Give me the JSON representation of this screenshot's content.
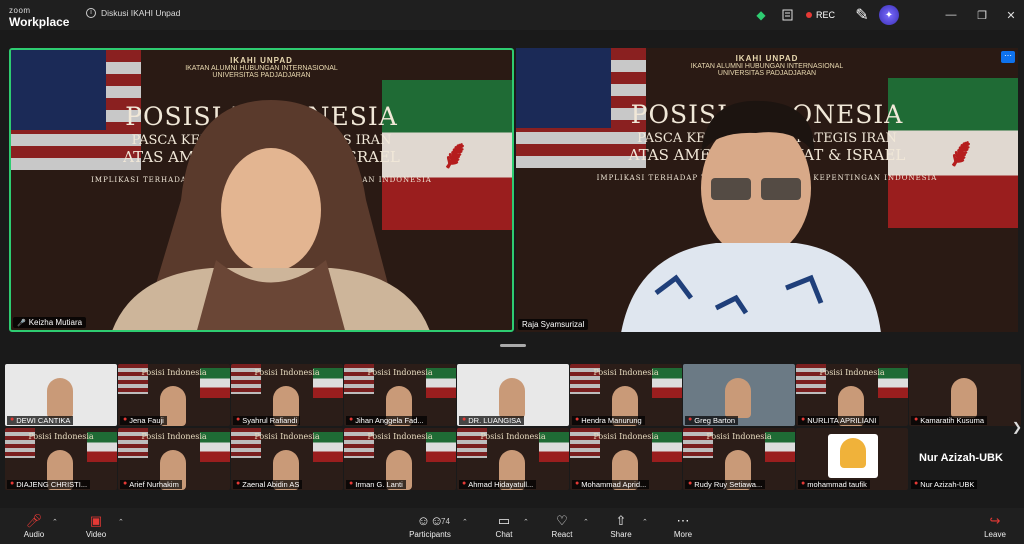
{
  "app": {
    "brand_line1": "zoom",
    "brand_line2": "Workplace"
  },
  "meeting": {
    "title": "Diskusi IKAHI Unpad"
  },
  "recording": {
    "label": "REC",
    "color": "#e53935"
  },
  "icons": {
    "security": "shield-check-icon",
    "notes": "document-icon",
    "annotate": "pen-icon",
    "ai": "ai-companion-icon"
  },
  "poster": {
    "brand": "IKAHI UNPAD",
    "org1": "IKATAN ALUMNI HUBUNGAN INTERNASIONAL",
    "org2": "UNIVERSITAS PADJADJARAN",
    "line1": "POSISI INDONESIA",
    "line2": "PASCA KEPUTUSAN STRATEGIS IRAN",
    "line3": "ATAS AMERIKA SERIKAT & ISRAEL",
    "line4": "IMPLIKASI TERHADAP TATANAN GLOBAL, DAN KEPENTINGAN INDONESIA"
  },
  "speakers": [
    {
      "name": "Keizha Mutiara",
      "active": true
    },
    {
      "name": "Raja Syamsurizal",
      "active": false
    }
  ],
  "gallery": [
    {
      "name": "DEWI CANTIKA"
    },
    {
      "name": "Jena Fauji"
    },
    {
      "name": "Syahrul Rafiandi"
    },
    {
      "name": "Jihan Anggela Fad..."
    },
    {
      "name": "DR. LUANGISA"
    },
    {
      "name": "Hendra Manurung"
    },
    {
      "name": "Greg Barton"
    },
    {
      "name": "NURLITA APRILIANI"
    },
    {
      "name": "Kamaratih Kusuma"
    },
    {
      "name": "DIAJENG CHRISTI..."
    },
    {
      "name": "Arief Nurhakim"
    },
    {
      "name": "Zaenal Abidin AS"
    },
    {
      "name": "Irman G. Lanti"
    },
    {
      "name": "Ahmad Hidayatull..."
    },
    {
      "name": "Mohammad Aprid..."
    },
    {
      "name": "Rudy Ruy Setiawa..."
    },
    {
      "name": "mohammad taufik"
    },
    {
      "name": "Nur Azizah-UBK",
      "display": "Nur Azizah-UBK"
    }
  ],
  "toolbar": {
    "audio": "Audio",
    "video": "Video",
    "participants": "Participants",
    "participants_count": "74",
    "chat": "Chat",
    "react": "React",
    "share": "Share",
    "more": "More",
    "leave": "Leave"
  },
  "colors": {
    "active_border": "#2ecc71",
    "muted": "#e53935",
    "accent": "#0e72ed"
  }
}
